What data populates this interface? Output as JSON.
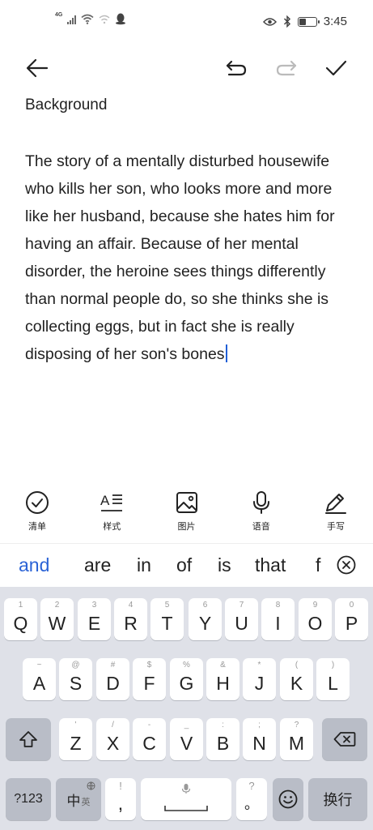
{
  "status_bar": {
    "network": "4G",
    "time": "3:45",
    "battery_percent": 40
  },
  "toolbar": {
    "back_icon": "back-arrow-icon",
    "undo_icon": "undo-icon",
    "redo_icon": "redo-icon",
    "done_icon": "checkmark-icon"
  },
  "note": {
    "title": "Background",
    "body": "The story of a mentally disturbed housewife who kills her son, who looks more and more like her husband, because she hates him for having an affair. Because of her mental disorder, the heroine sees things differently than normal people do, so she thinks she is collecting eggs, but in fact she is really disposing of her son's bones"
  },
  "format_bar": {
    "items": [
      {
        "label": "清单",
        "icon": "checklist-icon"
      },
      {
        "label": "样式",
        "icon": "text-style-icon"
      },
      {
        "label": "图片",
        "icon": "image-icon"
      },
      {
        "label": "语音",
        "icon": "microphone-icon"
      },
      {
        "label": "手写",
        "icon": "pen-icon"
      }
    ]
  },
  "suggestions": {
    "words": [
      "and",
      "are",
      "in",
      "of",
      "is",
      "that",
      "f"
    ],
    "accent_color": "#2b63d6"
  },
  "keyboard": {
    "row1": [
      {
        "sub": "1",
        "key": "Q"
      },
      {
        "sub": "2",
        "key": "W"
      },
      {
        "sub": "3",
        "key": "E"
      },
      {
        "sub": "4",
        "key": "R"
      },
      {
        "sub": "5",
        "key": "T"
      },
      {
        "sub": "6",
        "key": "Y"
      },
      {
        "sub": "7",
        "key": "U"
      },
      {
        "sub": "8",
        "key": "I"
      },
      {
        "sub": "9",
        "key": "O"
      },
      {
        "sub": "0",
        "key": "P"
      }
    ],
    "row2": [
      {
        "sub": "~",
        "key": "A"
      },
      {
        "sub": "@",
        "key": "S"
      },
      {
        "sub": "#",
        "key": "D"
      },
      {
        "sub": "$",
        "key": "F"
      },
      {
        "sub": "%",
        "key": "G"
      },
      {
        "sub": "&",
        "key": "H"
      },
      {
        "sub": "*",
        "key": "J"
      },
      {
        "sub": "(",
        "key": "K"
      },
      {
        "sub": ")",
        "key": "L"
      }
    ],
    "row3": [
      {
        "sub": "'",
        "key": "Z"
      },
      {
        "sub": "/",
        "key": "X"
      },
      {
        "sub": "-",
        "key": "C"
      },
      {
        "sub": "_",
        "key": "V"
      },
      {
        "sub": ":",
        "key": "B"
      },
      {
        "sub": ";",
        "key": "N"
      },
      {
        "sub": "?",
        "key": "M"
      }
    ],
    "num_key": "?123",
    "lang_key": "中",
    "lang_sub": "英",
    "comma_sub": "!",
    "comma_key": ",",
    "period_sub": "?",
    "period_key": "。",
    "enter_key": "换行"
  }
}
